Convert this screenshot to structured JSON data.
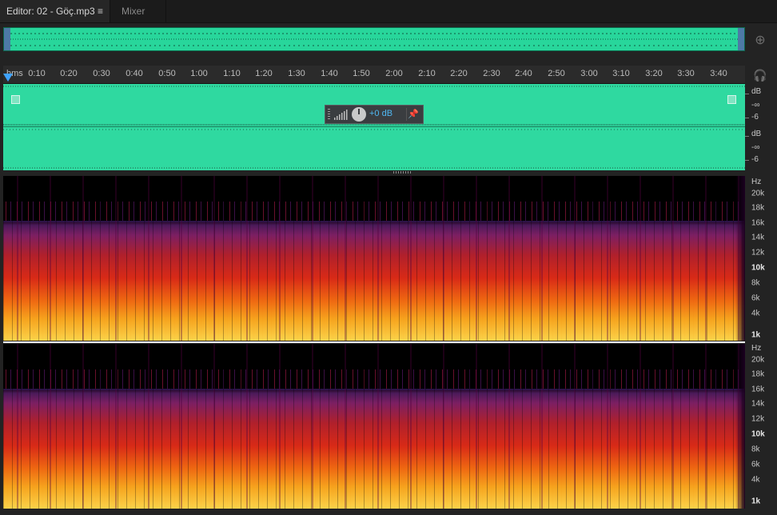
{
  "tabs": {
    "editor_label": "Editor: 02 - Göç.mp3",
    "editor_menu": "≡",
    "mixer_label": "Mixer"
  },
  "ruler": {
    "hms_label": "hms",
    "ticks": [
      "0:10",
      "0:20",
      "0:30",
      "0:40",
      "0:50",
      "1:00",
      "1:10",
      "1:20",
      "1:30",
      "1:40",
      "1:50",
      "2:00",
      "2:10",
      "2:20",
      "2:30",
      "2:40",
      "2:50",
      "3:00",
      "3:10",
      "3:20",
      "3:30",
      "3:40"
    ]
  },
  "hud": {
    "gain_value": "+0 dB"
  },
  "waveform_scale": {
    "ch1": {
      "unit": "dB",
      "inf": "-∞",
      "neg6": "-6"
    },
    "ch2": {
      "unit": "dB",
      "inf": "-∞",
      "neg6": "-6"
    }
  },
  "spectral_scale": {
    "unit": "Hz",
    "labels": [
      "20k",
      "18k",
      "16k",
      "14k",
      "12k",
      "10k",
      "8k",
      "6k",
      "4k",
      "1k"
    ],
    "bold_labels": [
      "10k",
      "1k"
    ]
  },
  "icons": {
    "zoom": "zoom-to-selection-icon",
    "headphones": "headphones-icon",
    "pin": "pin-icon",
    "volume_bars": "volume-bars-icon",
    "gain_knob": "gain-knob-icon"
  },
  "colors": {
    "waveform_bg": "#2fd9a0",
    "accent_blue": "#3ea2ff",
    "hud_value": "#4fb7f2"
  }
}
